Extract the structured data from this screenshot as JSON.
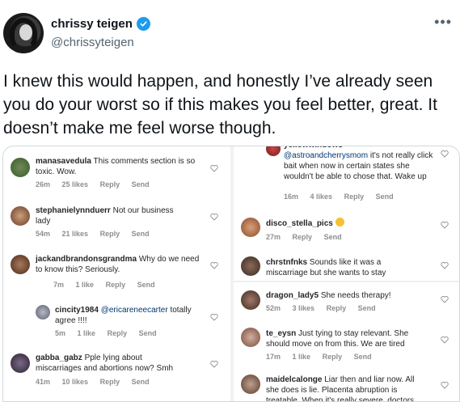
{
  "tweet": {
    "display_name": "chrissy teigen",
    "handle": "@chrissyteigen",
    "verified_icon": "verified-badge-icon",
    "more_icon": "more-options-icon",
    "text": "I knew this would happen, and honestly I’ve already seen you do your worst so if this makes you feel better, great. It doesn’t make me feel worse though."
  },
  "media": {
    "left_comments": [
      {
        "user": "manasavedula",
        "text": "This comments section is so toxic. Wow.",
        "time": "26m",
        "likes": "25 likes",
        "reply": "Reply",
        "send": "Send"
      },
      {
        "user": "stephanielynnduerr",
        "text": "Not our business lady",
        "time": "54m",
        "likes": "21 likes",
        "reply": "Reply",
        "send": "Send"
      },
      {
        "user": "jackandbrandonsgrandma",
        "text": "Why do we need to know this? Seriously.",
        "time": "7m",
        "likes": "1 like",
        "reply": "Reply",
        "send": "Send"
      },
      {
        "user": "cincity1984",
        "mention": "@ericareneecarter",
        "text": "totally agree !!!!",
        "time": "5m",
        "likes": "1 like",
        "reply": "Reply",
        "send": "Send"
      },
      {
        "user": "gabba_gabz",
        "text": "Pple lying about miscarriages and abortions now? Smh",
        "time": "41m",
        "likes": "10 likes",
        "reply": "Reply",
        "send": "Send"
      }
    ],
    "right_comments": [
      {
        "user": "yellowwindows",
        "mention": "@astroandcherrysmom",
        "text": "it's not really click bait when now in certain states she wouldn't be able to chose that. Wake up",
        "time": "16m",
        "likes": "4 likes",
        "reply": "Reply",
        "send": "Send"
      },
      {
        "user": "disco_stella_pics",
        "text": "",
        "time": "27m",
        "reply": "Reply",
        "send": "Send"
      },
      {
        "user": "chrstnfnks",
        "text": "Sounds like it was a miscarriage but she wants to stay"
      },
      {
        "user": "dragon_lady5",
        "text": "She needs therapy!",
        "time": "52m",
        "likes": "3 likes",
        "reply": "Reply",
        "send": "Send"
      },
      {
        "user": "te_eysn",
        "text": "Just tying to stay relevant. She should move on from this. We are tired",
        "time": "17m",
        "likes": "1 like",
        "reply": "Reply",
        "send": "Send"
      },
      {
        "user": "maidelcalonge",
        "text": "Liar then and liar now. All she does is lie. Placenta abruption is treatable. When it's really severe, doctors"
      }
    ]
  },
  "colors": {
    "verified": "#1d9bf0",
    "handle": "#536471",
    "mention": "#00376b",
    "meta": "#8e8e8e"
  }
}
